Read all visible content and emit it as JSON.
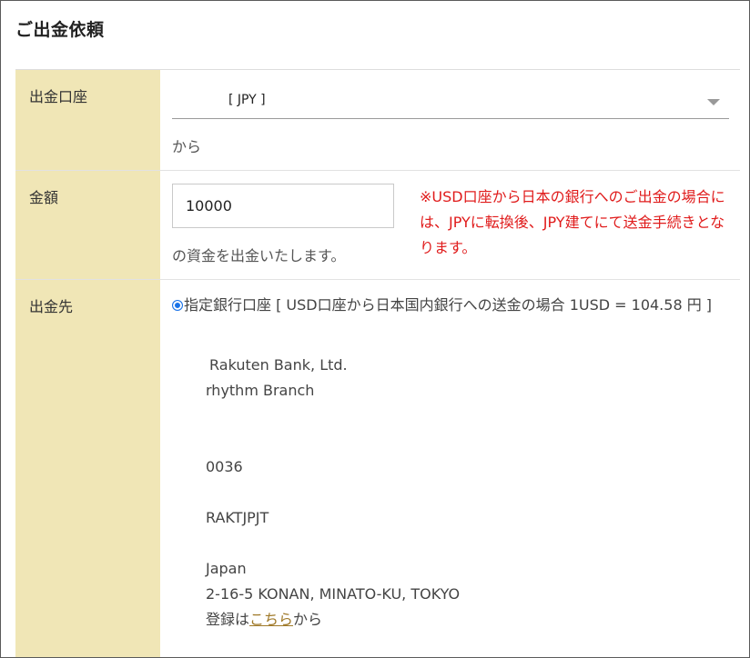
{
  "page": {
    "title": "ご出金依頼"
  },
  "account": {
    "label": "出金口座",
    "selected": "[ JPY ]",
    "suffix": "から"
  },
  "amount": {
    "label": "金額",
    "value": "10000",
    "suffix": "の資金を出金いたします。",
    "note": "※USD口座から日本の銀行へのご出金の場合には、JPYに転換後、JPY建てにて送金手続きとなります。"
  },
  "destination": {
    "label": "出金先",
    "option_label": "指定銀行口座 [ USD口座から日本国内銀行への送金の場合 1USD = 104.58 円 ]",
    "bank_name": "Rakuten Bank, Ltd.",
    "branch": "rhythm Branch",
    "code": "0036",
    "swift": "RAKTJPJT",
    "country": "Japan",
    "address": "2-16-5 KONAN, MINATO-KU, TOKYO",
    "register_prefix": "登録は",
    "register_link": "こちら",
    "register_suffix": "から"
  },
  "colors": {
    "label_bg": "#f0e6b6",
    "note_red": "#e01b1b",
    "link": "#a07a2a",
    "radio": "#1a73e8"
  }
}
